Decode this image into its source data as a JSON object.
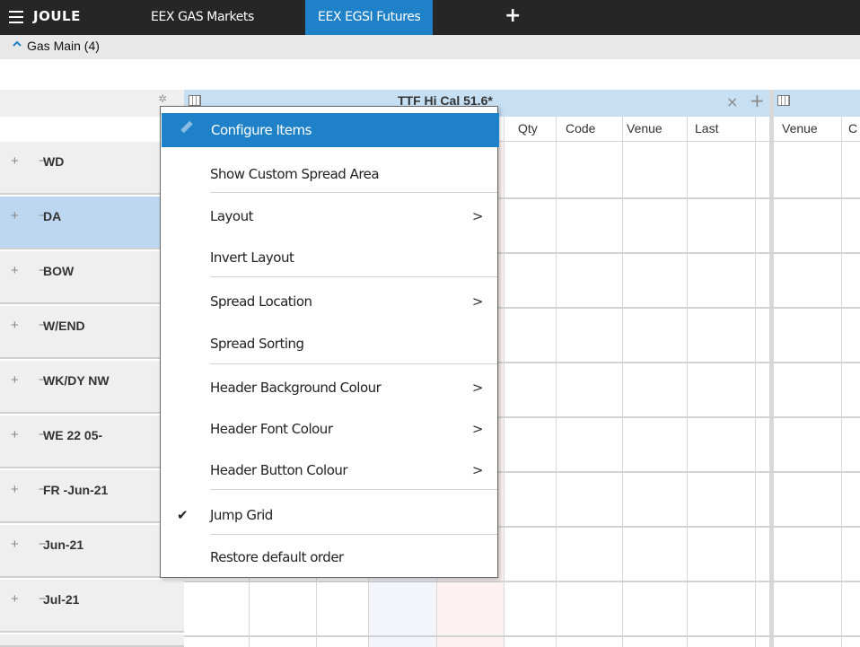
{
  "app": {
    "logo": "JOULE",
    "tabs": [
      {
        "label": "EEX GAS Markets",
        "active": false
      },
      {
        "label": "EEX EGSI Futures",
        "active": true
      }
    ],
    "add_tab": "+"
  },
  "group": {
    "label": "Gas Main (4)"
  },
  "spread": {
    "title": "TTF Hi Cal 51.6*",
    "close": "×",
    "add": "+",
    "columns": [
      "Qty",
      "Code",
      "Venue",
      "Last"
    ],
    "columns2": [
      "Venue",
      "C"
    ]
  },
  "rows": [
    {
      "label": "WD",
      "selected": false
    },
    {
      "label": "DA",
      "selected": true
    },
    {
      "label": "BOW",
      "selected": false
    },
    {
      "label": "W/END",
      "selected": false
    },
    {
      "label": "WK/DY NW",
      "selected": false
    },
    {
      "label": "WE 22 05-",
      "selected": false
    },
    {
      "label": "FR -Jun-21",
      "selected": false
    },
    {
      "label": "Jun-21",
      "selected": false
    },
    {
      "label": "Jul-21",
      "selected": false
    }
  ],
  "row_controls": "+ −",
  "context_menu": {
    "items": [
      {
        "label": "Configure Items",
        "highlighted": true,
        "submenu": false,
        "checked": false
      },
      {
        "label": "Show Custom Spread Area",
        "highlighted": false,
        "submenu": false,
        "checked": false
      },
      {
        "label": "Layout",
        "highlighted": false,
        "submenu": true,
        "checked": false
      },
      {
        "label": "Invert Layout",
        "highlighted": false,
        "submenu": false,
        "checked": false
      },
      {
        "label": "Spread Location",
        "highlighted": false,
        "submenu": true,
        "checked": false
      },
      {
        "label": "Spread Sorting",
        "highlighted": false,
        "submenu": false,
        "checked": false
      },
      {
        "label": "Header Background Colour",
        "highlighted": false,
        "submenu": true,
        "checked": false
      },
      {
        "label": "Header Font Colour",
        "highlighted": false,
        "submenu": true,
        "checked": false
      },
      {
        "label": "Header Button Colour",
        "highlighted": false,
        "submenu": true,
        "checked": false
      },
      {
        "label": "Jump Grid",
        "highlighted": false,
        "submenu": false,
        "checked": true
      },
      {
        "label": "Restore default order",
        "highlighted": false,
        "submenu": false,
        "checked": false
      }
    ],
    "submenu_arrow": ">",
    "check_mark": "✔"
  },
  "colors": {
    "topbar": "#262626",
    "accent": "#1f82c9",
    "selected_row": "#bcd7ef",
    "spread_header": "#c7dff3"
  }
}
